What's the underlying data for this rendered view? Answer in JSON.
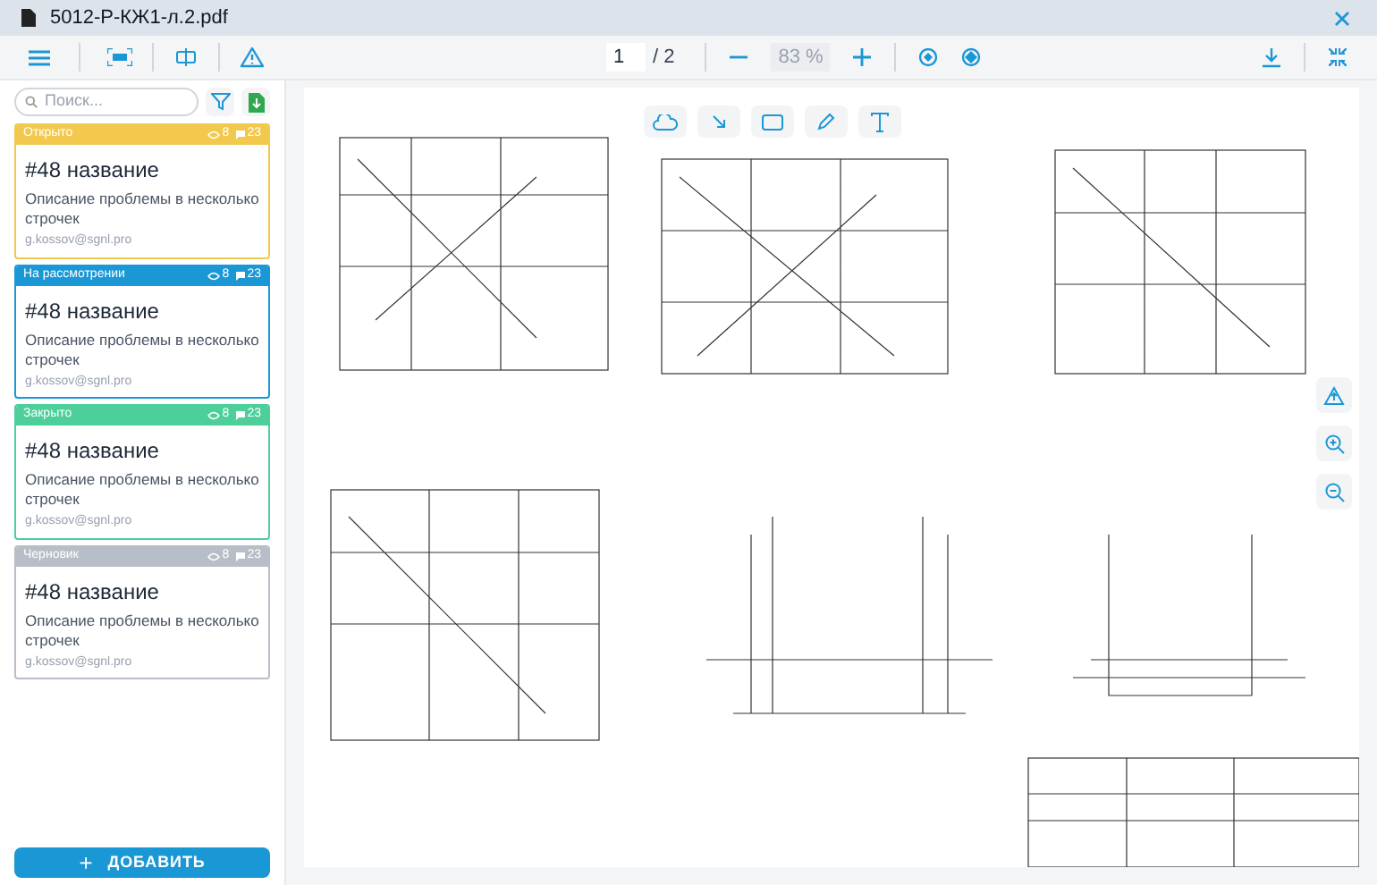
{
  "window": {
    "title": "5012-Р-КЖ1-л.2.pdf"
  },
  "toolbar": {
    "page": "1",
    "page_total": "/ 2",
    "zoom": "83 %"
  },
  "search": {
    "placeholder": "Поиск..."
  },
  "issues": [
    {
      "status": "Открыто",
      "color": "#f2c94c",
      "views": "8",
      "comments": "23",
      "title": "#48 название",
      "description": "Описание проблемы в несколько строчек",
      "author": "g.kossov@sgnl.pro"
    },
    {
      "status": "На рассмотрении",
      "color": "#1a97d5",
      "views": "8",
      "comments": "23",
      "title": "#48 название",
      "description": "Описание проблемы в несколько строчек",
      "author": "g.kossov@sgnl.pro"
    },
    {
      "status": "Закрыто",
      "color": "#4ccf9b",
      "views": "8",
      "comments": "23",
      "title": "#48 название",
      "description": "Описание проблемы в несколько строчек",
      "author": "g.kossov@sgnl.pro"
    },
    {
      "status": "Черновик",
      "color": "#b8bec8",
      "views": "8",
      "comments": "23",
      "title": "#48 название",
      "description": "Описание проблемы в несколько строчек",
      "author": "g.kossov@sgnl.pro"
    }
  ],
  "add_button": {
    "label": "ДОБАВИТЬ",
    "icon": "+"
  }
}
